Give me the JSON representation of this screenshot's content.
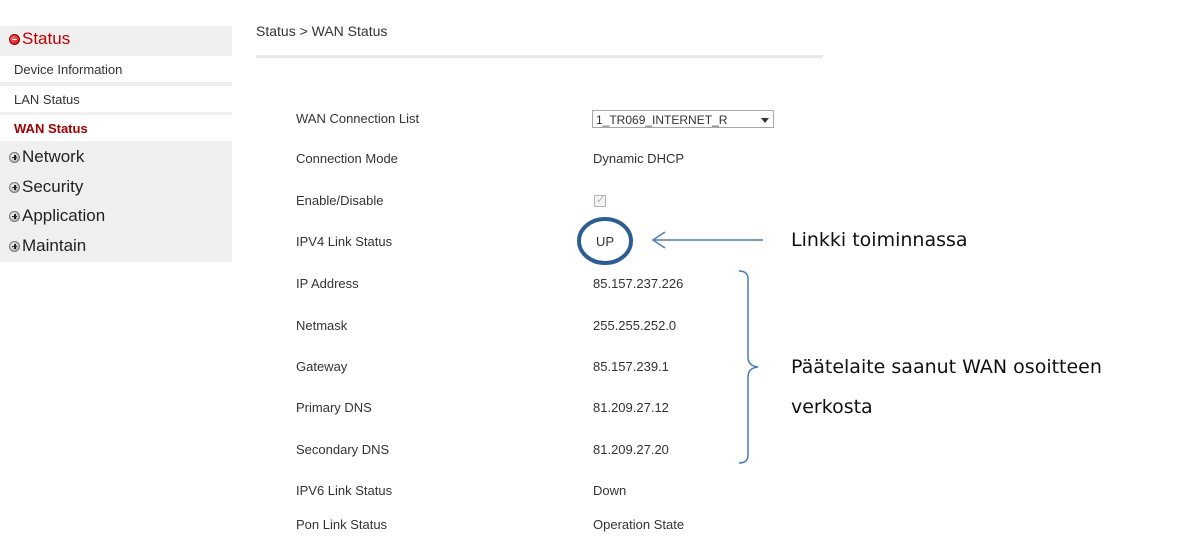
{
  "sidebar": {
    "status": "Status",
    "items": [
      "Device Information",
      "LAN Status",
      "WAN Status"
    ],
    "network": "Network",
    "security": "Security",
    "application": "Application",
    "maintain": "Maintain"
  },
  "breadcrumb": "Status > WAN Status",
  "fields": {
    "wan_connection_list": {
      "label": "WAN Connection List",
      "value": "1_TR069_INTERNET_R"
    },
    "connection_mode": {
      "label": "Connection Mode",
      "value": "Dynamic DHCP"
    },
    "enable_disable": {
      "label": "Enable/Disable",
      "checked": true
    },
    "ipv4_link_status": {
      "label": "IPV4 Link Status",
      "value": "UP"
    },
    "ip_address": {
      "label": "IP Address",
      "value": "85.157.237.226"
    },
    "netmask": {
      "label": "Netmask",
      "value": "255.255.252.0"
    },
    "gateway": {
      "label": "Gateway",
      "value": "85.157.239.1"
    },
    "primary_dns": {
      "label": "Primary DNS",
      "value": "81.209.27.12"
    },
    "secondary_dns": {
      "label": "Secondary DNS",
      "value": "81.209.27.20"
    },
    "ipv6_link_status": {
      "label": "IPV6 Link Status",
      "value": "Down"
    },
    "pon_link_status": {
      "label": "Pon Link Status",
      "value": "Operation State"
    }
  },
  "annotations": {
    "link_note": "Linkki toiminnassa",
    "wan_note_line1": "Päätelaite saanut WAN osoitteen",
    "wan_note_line2": "verkosta"
  },
  "colors": {
    "active_menu": "#c00000",
    "annotation_blue": "#2e5d92",
    "sidebar_bg": "#efefef"
  }
}
